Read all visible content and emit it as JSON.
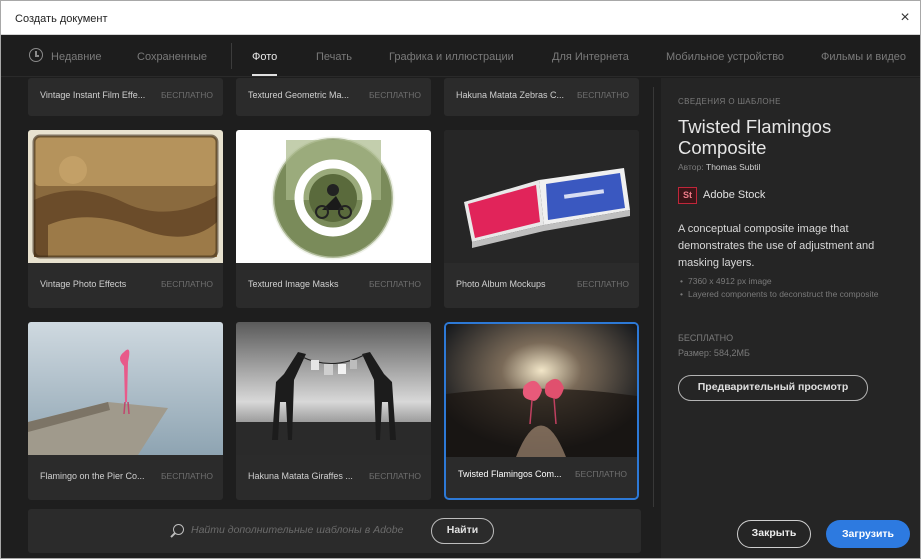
{
  "window": {
    "title": "Создать документ",
    "close_glyph": "×"
  },
  "tabs": [
    {
      "label": "Недавние"
    },
    {
      "label": "Сохраненные"
    },
    {
      "label": "Фото"
    },
    {
      "label": "Печать"
    },
    {
      "label": "Графика и иллюстрации"
    },
    {
      "label": "Для Интернета"
    },
    {
      "label": "Мобильное устройство"
    },
    {
      "label": "Фильмы и видео"
    }
  ],
  "active_tab": "Фото",
  "templates": [
    {
      "name": "Vintage Instant Film Effe...",
      "price": "БЕСПЛАТНО"
    },
    {
      "name": "Textured Geometric Ma...",
      "price": "БЕСПЛАТНО"
    },
    {
      "name": "Hakuna Matata Zebras C...",
      "price": "БЕСПЛАТНО"
    },
    {
      "name": "Vintage Photo Effects",
      "price": "БЕСПЛАТНО"
    },
    {
      "name": "Textured Image Masks",
      "price": "БЕСПЛАТНО"
    },
    {
      "name": "Photo Album Mockups",
      "price": "БЕСПЛАТНО"
    },
    {
      "name": "Flamingo on the Pier Co...",
      "price": "БЕСПЛАТНО"
    },
    {
      "name": "Hakuna Matata Giraffes ...",
      "price": "БЕСПЛАТНО"
    },
    {
      "name": "Twisted Flamingos Com...",
      "price": "БЕСПЛАТНО"
    }
  ],
  "search": {
    "placeholder": "Найти дополнительные шаблоны в Adobe",
    "button_label": "Найти"
  },
  "details": {
    "section_heading": "СВЕДЕНИЯ О ШАБЛОНЕ",
    "title": "Twisted Flamingos Composite",
    "author_prefix": "Автор:",
    "author": "Thomas Subtil",
    "source_icon_text": "St",
    "source": "Adobe Stock",
    "description": "A conceptual composite image that demonstrates the use of adjustment and masking layers.",
    "bullets": [
      "7360 x 4912 px image",
      "Layered components to deconstruct the composite"
    ],
    "price": "БЕСПЛАТНО",
    "size": "Размер: 584,2МБ",
    "preview_label": "Предварительный просмотр"
  },
  "footer": {
    "close_label": "Закрыть",
    "load_label": "Загрузить"
  },
  "colors": {
    "accent": "#2d7ae0",
    "background": "#1e1e1e",
    "card": "#2b2b2b",
    "stock_red": "#c0263a"
  }
}
